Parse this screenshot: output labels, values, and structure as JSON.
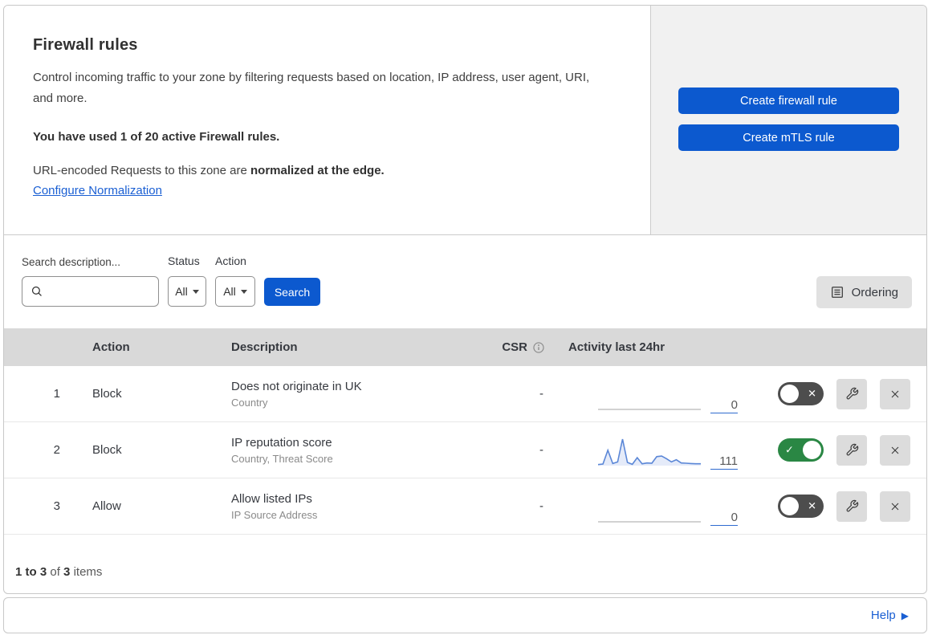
{
  "colors": {
    "accent": "#0c59cf",
    "green": "#2a8744",
    "toggle_off": "#4d4d4d",
    "link": "#1a5fd3"
  },
  "intro": {
    "title": "Firewall rules",
    "description": "Control incoming traffic to your zone by filtering requests based on location, IP address, user agent, URI, and more.",
    "usage": "You have used 1 of 20 active Firewall rules.",
    "normalization_prefix": "URL-encoded Requests to this zone are ",
    "normalization_bold": "normalized at the edge.",
    "normalization_link": "Configure Normalization"
  },
  "cta": {
    "create_firewall_rule": "Create firewall rule",
    "create_mtls_rule": "Create mTLS rule"
  },
  "filters": {
    "search_label": "Search description...",
    "status_label": "Status",
    "status_value": "All",
    "action_label": "Action",
    "action_value": "All",
    "search_button": "Search",
    "ordering_button": "Ordering"
  },
  "table": {
    "headers": {
      "action": "Action",
      "description": "Description",
      "csr": "CSR",
      "activity": "Activity last 24hr"
    },
    "rows": [
      {
        "priority": "1",
        "action": "Block",
        "description": "Does not originate in UK",
        "criteria": "Country",
        "csr": "-",
        "count": "0",
        "enabled": false,
        "sparkline": null
      },
      {
        "priority": "2",
        "action": "Block",
        "description": "IP reputation score",
        "criteria": "Country, Threat Score",
        "csr": "-",
        "count": "111",
        "enabled": true,
        "sparkline": [
          4,
          6,
          58,
          8,
          14,
          100,
          12,
          5,
          30,
          7,
          10,
          9,
          34,
          36,
          26,
          14,
          22,
          10,
          9,
          8,
          7,
          7
        ]
      },
      {
        "priority": "3",
        "action": "Allow",
        "description": "Allow listed IPs",
        "criteria": "IP Source Address",
        "csr": "-",
        "count": "0",
        "enabled": false,
        "sparkline": null
      }
    ]
  },
  "footer": {
    "range": "1 to 3",
    "of": "of",
    "total": "3",
    "items": "items"
  },
  "help": {
    "label": "Help"
  }
}
